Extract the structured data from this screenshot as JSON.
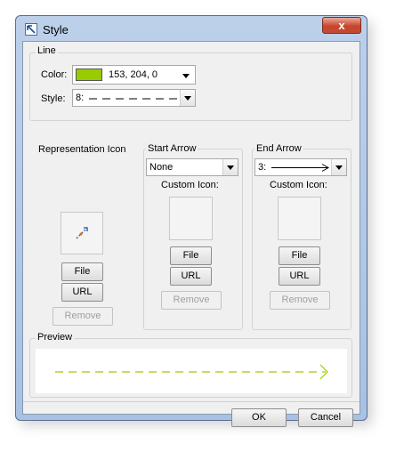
{
  "window": {
    "title": "Style",
    "close_label": "x"
  },
  "line_group": {
    "label": "Line",
    "color_label": "Color:",
    "color_value": "153, 204, 0",
    "swatch_color": "#99cc00",
    "style_label": "Style:",
    "style_value": "8:"
  },
  "representation": {
    "label": "Representation Icon",
    "file_label": "File",
    "url_label": "URL",
    "remove_label": "Remove"
  },
  "start_arrow": {
    "label": "Start Arrow",
    "selected": "None",
    "custom_icon_label": "Custom Icon:",
    "file_label": "File",
    "url_label": "URL",
    "remove_label": "Remove"
  },
  "end_arrow": {
    "label": "End Arrow",
    "selected": "3:",
    "custom_icon_label": "Custom Icon:",
    "file_label": "File",
    "url_label": "URL",
    "remove_label": "Remove"
  },
  "preview": {
    "label": "Preview"
  },
  "footer": {
    "ok_label": "OK",
    "cancel_label": "Cancel"
  }
}
